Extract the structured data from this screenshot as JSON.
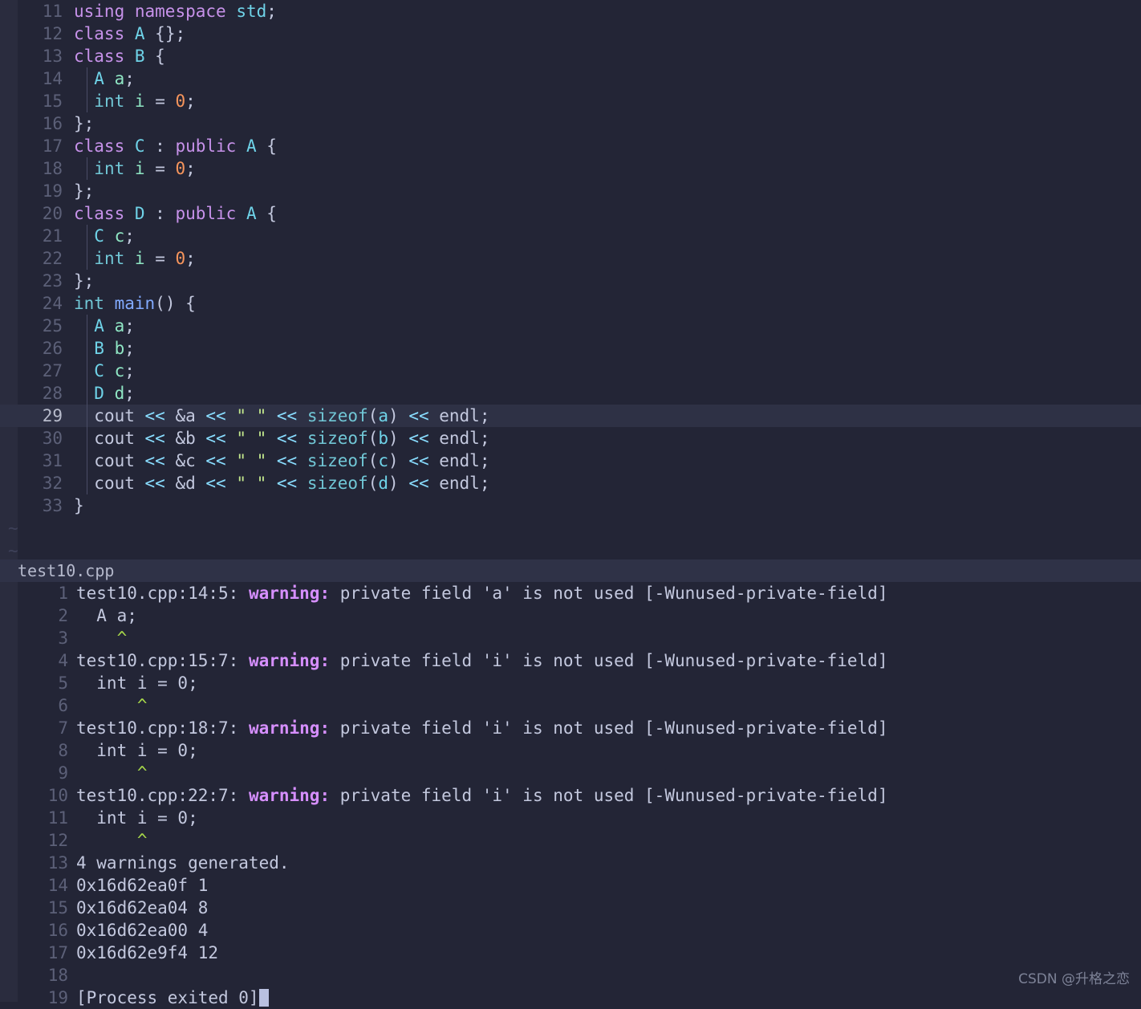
{
  "theme": {
    "editor_bg": "#232536",
    "rail_bg": "#2a2c3e",
    "active_line_bg": "#2e3145",
    "status_bar_bg": "#2f3247",
    "line_number_fg": "#5c6078",
    "text_fg": "#c3c8de",
    "keyword": "#c792ea",
    "type": "#6fd3e8",
    "number": "#f7955c",
    "function": "#82aaff",
    "string": "#c3e88d",
    "operator": "#89ddff",
    "warning_label": "#d68fff",
    "caret_marker": "#a8d94a",
    "cursor": "#b9c0e0"
  },
  "editor": {
    "active_line": 29,
    "first_visible_line": 11,
    "tildes": [
      "~",
      "~"
    ],
    "lines": [
      {
        "n": 11,
        "indent": 0,
        "tokens": [
          {
            "t": "using",
            "c": "kw"
          },
          {
            "t": " ",
            "c": "punc"
          },
          {
            "t": "namespace",
            "c": "kw"
          },
          {
            "t": " ",
            "c": "punc"
          },
          {
            "t": "std",
            "c": "typ"
          },
          {
            "t": ";",
            "c": "punc"
          }
        ]
      },
      {
        "n": 12,
        "indent": 0,
        "tokens": [
          {
            "t": "class",
            "c": "kw"
          },
          {
            "t": " ",
            "c": "punc"
          },
          {
            "t": "A",
            "c": "typ"
          },
          {
            "t": " {};",
            "c": "punc"
          }
        ]
      },
      {
        "n": 13,
        "indent": 0,
        "tokens": [
          {
            "t": "class",
            "c": "kw"
          },
          {
            "t": " ",
            "c": "punc"
          },
          {
            "t": "B",
            "c": "typ"
          },
          {
            "t": " {",
            "c": "punc"
          }
        ]
      },
      {
        "n": 14,
        "indent": 1,
        "tokens": [
          {
            "t": "  ",
            "c": "punc"
          },
          {
            "t": "A",
            "c": "typ"
          },
          {
            "t": " ",
            "c": "punc"
          },
          {
            "t": "a",
            "c": "var"
          },
          {
            "t": ";",
            "c": "punc"
          }
        ]
      },
      {
        "n": 15,
        "indent": 1,
        "tokens": [
          {
            "t": "  ",
            "c": "punc"
          },
          {
            "t": "int",
            "c": "ty2"
          },
          {
            "t": " ",
            "c": "punc"
          },
          {
            "t": "i",
            "c": "var"
          },
          {
            "t": " = ",
            "c": "punc"
          },
          {
            "t": "0",
            "c": "num"
          },
          {
            "t": ";",
            "c": "punc"
          }
        ]
      },
      {
        "n": 16,
        "indent": 0,
        "tokens": [
          {
            "t": "};",
            "c": "punc"
          }
        ]
      },
      {
        "n": 17,
        "indent": 0,
        "tokens": [
          {
            "t": "class",
            "c": "kw"
          },
          {
            "t": " ",
            "c": "punc"
          },
          {
            "t": "C",
            "c": "typ"
          },
          {
            "t": " : ",
            "c": "punc"
          },
          {
            "t": "public",
            "c": "kw"
          },
          {
            "t": " ",
            "c": "punc"
          },
          {
            "t": "A",
            "c": "typ"
          },
          {
            "t": " {",
            "c": "punc"
          }
        ]
      },
      {
        "n": 18,
        "indent": 1,
        "tokens": [
          {
            "t": "  ",
            "c": "punc"
          },
          {
            "t": "int",
            "c": "ty2"
          },
          {
            "t": " ",
            "c": "punc"
          },
          {
            "t": "i",
            "c": "var"
          },
          {
            "t": " = ",
            "c": "punc"
          },
          {
            "t": "0",
            "c": "num"
          },
          {
            "t": ";",
            "c": "punc"
          }
        ]
      },
      {
        "n": 19,
        "indent": 0,
        "tokens": [
          {
            "t": "};",
            "c": "punc"
          }
        ]
      },
      {
        "n": 20,
        "indent": 0,
        "tokens": [
          {
            "t": "class",
            "c": "kw"
          },
          {
            "t": " ",
            "c": "punc"
          },
          {
            "t": "D",
            "c": "typ"
          },
          {
            "t": " : ",
            "c": "punc"
          },
          {
            "t": "public",
            "c": "kw"
          },
          {
            "t": " ",
            "c": "punc"
          },
          {
            "t": "A",
            "c": "typ"
          },
          {
            "t": " {",
            "c": "punc"
          }
        ]
      },
      {
        "n": 21,
        "indent": 1,
        "tokens": [
          {
            "t": "  ",
            "c": "punc"
          },
          {
            "t": "C",
            "c": "typ"
          },
          {
            "t": " ",
            "c": "punc"
          },
          {
            "t": "c",
            "c": "var"
          },
          {
            "t": ";",
            "c": "punc"
          }
        ]
      },
      {
        "n": 22,
        "indent": 1,
        "tokens": [
          {
            "t": "  ",
            "c": "punc"
          },
          {
            "t": "int",
            "c": "ty2"
          },
          {
            "t": " ",
            "c": "punc"
          },
          {
            "t": "i",
            "c": "var"
          },
          {
            "t": " = ",
            "c": "punc"
          },
          {
            "t": "0",
            "c": "num"
          },
          {
            "t": ";",
            "c": "punc"
          }
        ]
      },
      {
        "n": 23,
        "indent": 0,
        "tokens": [
          {
            "t": "};",
            "c": "punc"
          }
        ]
      },
      {
        "n": 24,
        "indent": 0,
        "tokens": [
          {
            "t": "int",
            "c": "ty2"
          },
          {
            "t": " ",
            "c": "punc"
          },
          {
            "t": "main",
            "c": "fn"
          },
          {
            "t": "() {",
            "c": "punc"
          }
        ]
      },
      {
        "n": 25,
        "indent": 1,
        "tokens": [
          {
            "t": "  ",
            "c": "punc"
          },
          {
            "t": "A",
            "c": "typ"
          },
          {
            "t": " ",
            "c": "punc"
          },
          {
            "t": "a",
            "c": "var"
          },
          {
            "t": ";",
            "c": "punc"
          }
        ]
      },
      {
        "n": 26,
        "indent": 1,
        "tokens": [
          {
            "t": "  ",
            "c": "punc"
          },
          {
            "t": "B",
            "c": "typ"
          },
          {
            "t": " ",
            "c": "punc"
          },
          {
            "t": "b",
            "c": "var"
          },
          {
            "t": ";",
            "c": "punc"
          }
        ]
      },
      {
        "n": 27,
        "indent": 1,
        "tokens": [
          {
            "t": "  ",
            "c": "punc"
          },
          {
            "t": "C",
            "c": "typ"
          },
          {
            "t": " ",
            "c": "punc"
          },
          {
            "t": "c",
            "c": "var"
          },
          {
            "t": ";",
            "c": "punc"
          }
        ]
      },
      {
        "n": 28,
        "indent": 1,
        "tokens": [
          {
            "t": "  ",
            "c": "punc"
          },
          {
            "t": "D",
            "c": "typ"
          },
          {
            "t": " ",
            "c": "punc"
          },
          {
            "t": "d",
            "c": "var"
          },
          {
            "t": ";",
            "c": "punc"
          }
        ]
      },
      {
        "n": 29,
        "indent": 1,
        "tokens": [
          {
            "t": "  ",
            "c": "punc"
          },
          {
            "t": "cout",
            "c": "punc"
          },
          {
            "t": " << ",
            "c": "op"
          },
          {
            "t": "&a",
            "c": "punc"
          },
          {
            "t": " << ",
            "c": "op"
          },
          {
            "t": "\" \"",
            "c": "str"
          },
          {
            "t": " << ",
            "c": "op"
          },
          {
            "t": "sizeof",
            "c": "ty2"
          },
          {
            "t": "(",
            "c": "punc"
          },
          {
            "t": "a",
            "c": "typ"
          },
          {
            "t": ")",
            "c": "punc"
          },
          {
            "t": " << ",
            "c": "op"
          },
          {
            "t": "endl",
            "c": "punc"
          },
          {
            "t": ";",
            "c": "punc"
          }
        ]
      },
      {
        "n": 30,
        "indent": 1,
        "tokens": [
          {
            "t": "  ",
            "c": "punc"
          },
          {
            "t": "cout",
            "c": "punc"
          },
          {
            "t": " << ",
            "c": "op"
          },
          {
            "t": "&b",
            "c": "punc"
          },
          {
            "t": " << ",
            "c": "op"
          },
          {
            "t": "\" \"",
            "c": "str"
          },
          {
            "t": " << ",
            "c": "op"
          },
          {
            "t": "sizeof",
            "c": "ty2"
          },
          {
            "t": "(",
            "c": "punc"
          },
          {
            "t": "b",
            "c": "typ"
          },
          {
            "t": ")",
            "c": "punc"
          },
          {
            "t": " << ",
            "c": "op"
          },
          {
            "t": "endl",
            "c": "punc"
          },
          {
            "t": ";",
            "c": "punc"
          }
        ]
      },
      {
        "n": 31,
        "indent": 1,
        "tokens": [
          {
            "t": "  ",
            "c": "punc"
          },
          {
            "t": "cout",
            "c": "punc"
          },
          {
            "t": " << ",
            "c": "op"
          },
          {
            "t": "&c",
            "c": "punc"
          },
          {
            "t": " << ",
            "c": "op"
          },
          {
            "t": "\" \"",
            "c": "str"
          },
          {
            "t": " << ",
            "c": "op"
          },
          {
            "t": "sizeof",
            "c": "ty2"
          },
          {
            "t": "(",
            "c": "punc"
          },
          {
            "t": "c",
            "c": "typ"
          },
          {
            "t": ")",
            "c": "punc"
          },
          {
            "t": " << ",
            "c": "op"
          },
          {
            "t": "endl",
            "c": "punc"
          },
          {
            "t": ";",
            "c": "punc"
          }
        ]
      },
      {
        "n": 32,
        "indent": 1,
        "tokens": [
          {
            "t": "  ",
            "c": "punc"
          },
          {
            "t": "cout",
            "c": "punc"
          },
          {
            "t": " << ",
            "c": "op"
          },
          {
            "t": "&d",
            "c": "punc"
          },
          {
            "t": " << ",
            "c": "op"
          },
          {
            "t": "\" \"",
            "c": "str"
          },
          {
            "t": " << ",
            "c": "op"
          },
          {
            "t": "sizeof",
            "c": "ty2"
          },
          {
            "t": "(",
            "c": "punc"
          },
          {
            "t": "d",
            "c": "typ"
          },
          {
            "t": ")",
            "c": "punc"
          },
          {
            "t": " << ",
            "c": "op"
          },
          {
            "t": "endl",
            "c": "punc"
          },
          {
            "t": ";",
            "c": "punc"
          }
        ]
      },
      {
        "n": 33,
        "indent": 0,
        "tokens": [
          {
            "t": "}",
            "c": "punc"
          }
        ]
      }
    ]
  },
  "status_bar": {
    "filename": "test10.cpp"
  },
  "terminal": {
    "rows": [
      {
        "n": 1,
        "segs": [
          {
            "t": "test10.cpp:14:5: ",
            "c": "bold"
          },
          {
            "t": "warning:",
            "c": "wlabel"
          },
          {
            "t": " private field 'a' is not used [-Wunused-private-field]",
            "c": "bold"
          }
        ]
      },
      {
        "n": 2,
        "segs": [
          {
            "t": "  A a;",
            "c": "plain"
          }
        ]
      },
      {
        "n": 3,
        "segs": [
          {
            "t": "    ^",
            "c": "caret"
          }
        ]
      },
      {
        "n": 4,
        "segs": [
          {
            "t": "test10.cpp:15:7: ",
            "c": "bold"
          },
          {
            "t": "warning:",
            "c": "wlabel"
          },
          {
            "t": " private field 'i' is not used [-Wunused-private-field]",
            "c": "bold"
          }
        ]
      },
      {
        "n": 5,
        "segs": [
          {
            "t": "  int i = 0;",
            "c": "plain"
          }
        ]
      },
      {
        "n": 6,
        "segs": [
          {
            "t": "      ^",
            "c": "caret"
          }
        ]
      },
      {
        "n": 7,
        "segs": [
          {
            "t": "test10.cpp:18:7: ",
            "c": "bold"
          },
          {
            "t": "warning:",
            "c": "wlabel"
          },
          {
            "t": " private field 'i' is not used [-Wunused-private-field]",
            "c": "bold"
          }
        ]
      },
      {
        "n": 8,
        "segs": [
          {
            "t": "  int i = 0;",
            "c": "plain"
          }
        ]
      },
      {
        "n": 9,
        "segs": [
          {
            "t": "      ^",
            "c": "caret"
          }
        ]
      },
      {
        "n": 10,
        "segs": [
          {
            "t": "test10.cpp:22:7: ",
            "c": "bold"
          },
          {
            "t": "warning:",
            "c": "wlabel"
          },
          {
            "t": " private field 'i' is not used [-Wunused-private-field]",
            "c": "bold"
          }
        ]
      },
      {
        "n": 11,
        "segs": [
          {
            "t": "  int i = 0;",
            "c": "plain"
          }
        ]
      },
      {
        "n": 12,
        "segs": [
          {
            "t": "      ^",
            "c": "caret"
          }
        ]
      },
      {
        "n": 13,
        "segs": [
          {
            "t": "4 warnings generated.",
            "c": "plain"
          }
        ]
      },
      {
        "n": 14,
        "segs": [
          {
            "t": "0x16d62ea0f 1",
            "c": "plain"
          }
        ]
      },
      {
        "n": 15,
        "segs": [
          {
            "t": "0x16d62ea04 8",
            "c": "plain"
          }
        ]
      },
      {
        "n": 16,
        "segs": [
          {
            "t": "0x16d62ea00 4",
            "c": "plain"
          }
        ]
      },
      {
        "n": 17,
        "segs": [
          {
            "t": "0x16d62e9f4 12",
            "c": "plain"
          }
        ]
      },
      {
        "n": 18,
        "segs": [
          {
            "t": "",
            "c": "plain"
          }
        ]
      },
      {
        "n": 19,
        "segs": [
          {
            "t": "[Process exited 0]",
            "c": "plain"
          },
          {
            "t": "",
            "c": "cursor"
          }
        ]
      }
    ]
  },
  "watermark": {
    "text": "CSDN @升格之恋"
  }
}
